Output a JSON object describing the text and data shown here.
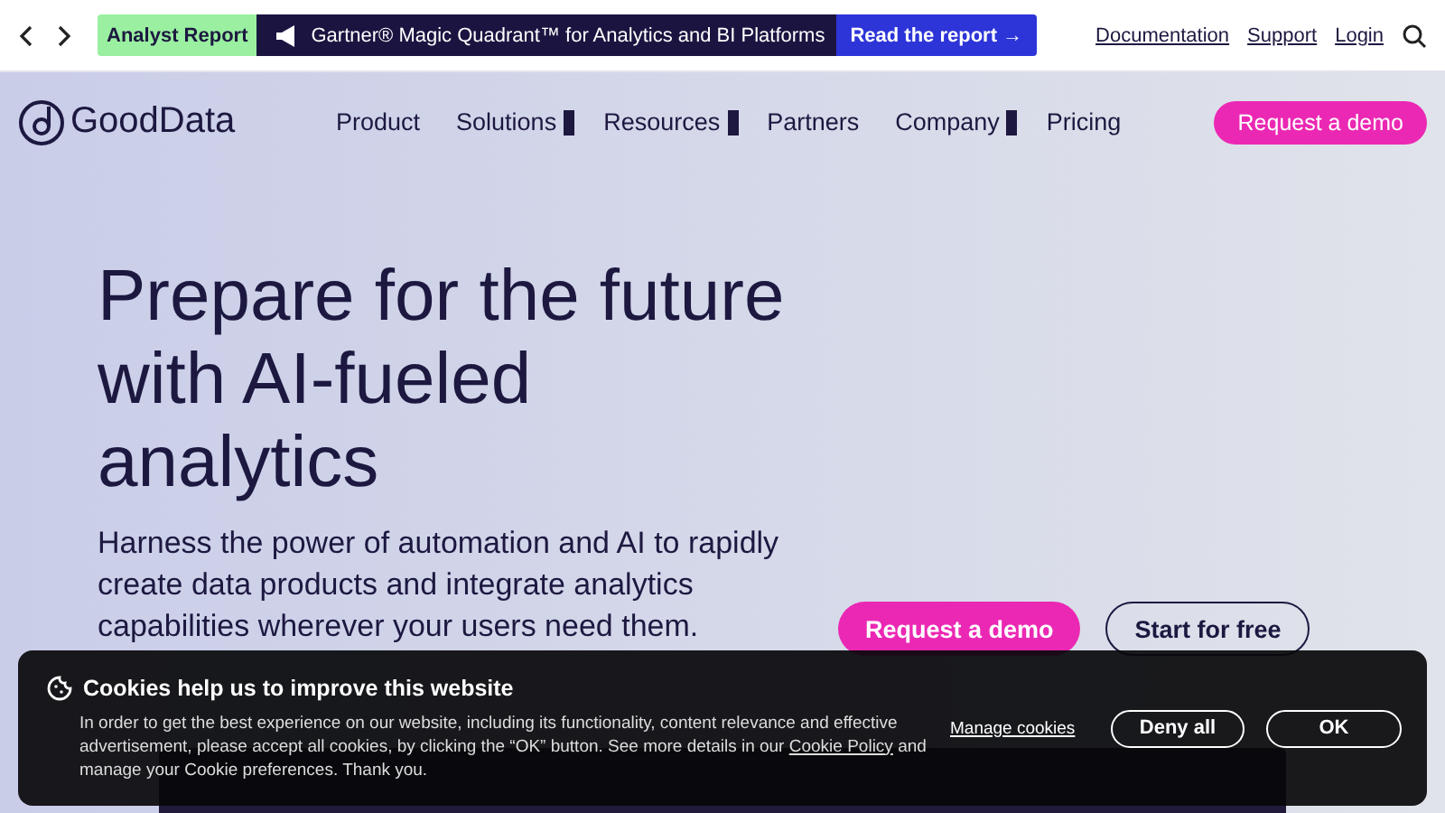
{
  "topbar": {
    "badge": "Analyst Report",
    "promo": "Gartner® Magic Quadrant™ for Analytics and BI Platforms",
    "promo_link": "Read the report →",
    "links": [
      "Documentation",
      "Support",
      "Login"
    ]
  },
  "nav": {
    "logo": "GoodData",
    "items": [
      {
        "label": "Product",
        "dropdown": false
      },
      {
        "label": "Solutions",
        "dropdown": true
      },
      {
        "label": "Resources",
        "dropdown": true
      },
      {
        "label": "Partners",
        "dropdown": false
      },
      {
        "label": "Company",
        "dropdown": true
      },
      {
        "label": "Pricing",
        "dropdown": false
      }
    ],
    "cta": "Request a demo"
  },
  "hero": {
    "title": "Prepare for the future with AI-fueled analytics",
    "text": "Harness the power of automation and AI to rapidly create data products and integrate analytics capabilities wherever your users need them.",
    "actions": [
      {
        "label": "Request a demo",
        "kind": "primary"
      },
      {
        "label": "Start for free",
        "kind": "outline"
      }
    ]
  },
  "cookies": {
    "title": "Cookies help us to improve this website",
    "text": "In order to get the best experience on our website, including its functionality, content relevance and effective advertisement, please accept all cookies, by clicking the “OK” button. See more details in our ",
    "link": "Cookie Policy",
    "text_end": " and manage your Cookie preferences. Thank you.",
    "manage": "Manage cookies",
    "buttons": [
      "Deny all",
      "OK"
    ]
  }
}
